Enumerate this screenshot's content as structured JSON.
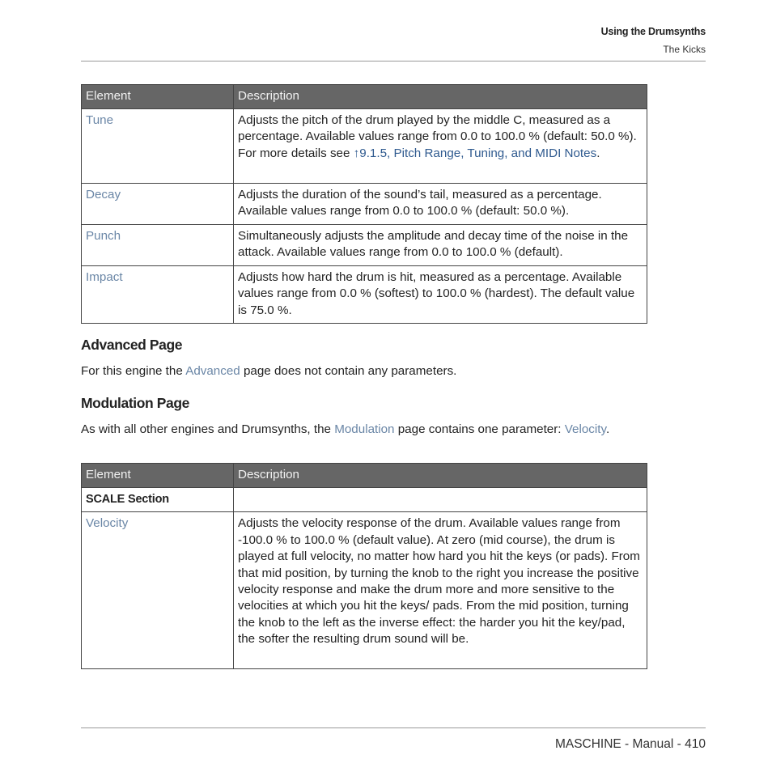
{
  "header": {
    "chapter": "Using the Drumsynths",
    "section": "The Kicks"
  },
  "table1": {
    "columns": [
      "Element",
      "Description"
    ],
    "rows": [
      {
        "element": "Tune",
        "desc_before": "Adjusts the pitch of the drum played by the middle C, measured as a percentage. Available values range from 0.0 to 100.0 % (default: 50.0 %). For more details see ",
        "desc_link": "↑9.1.5, Pitch Range, Tuning, and MIDI Notes",
        "desc_after": "."
      },
      {
        "element": "Decay",
        "desc": "Adjusts the duration of the sound’s tail, measured as a percentage. Available values range from 0.0 to 100.0 % (default: 50.0 %)."
      },
      {
        "element": "Punch",
        "desc": "Simultaneously adjusts the amplitude and decay time of the noise in the attack. Available values range from 0.0 to 100.0 % (default)."
      },
      {
        "element": "Impact",
        "desc": "Adjusts how hard the drum is hit, measured as a percentage. Available values range from 0.0 % (softest) to 100.0 % (hardest). The default value is 75.0 %."
      }
    ]
  },
  "advanced": {
    "heading": "Advanced Page",
    "text_before": "For this engine the ",
    "link": "Advanced",
    "text_after": " page does not contain any parameters."
  },
  "modulation": {
    "heading": "Modulation Page",
    "text_before": "As with all other engines and Drumsynths, the ",
    "link": "Modulation",
    "text_middle": " page contains one parameter: ",
    "param_link": "Veloc­ity",
    "text_after": "."
  },
  "table2": {
    "columns": [
      "Element",
      "Description"
    ],
    "section_label": "SCALE Section",
    "rows": [
      {
        "element": "Velocity",
        "desc": "Adjusts the velocity response of the drum. Available values range from -100.0 % to 100.0 % (default value). At zero (mid course), the drum is played at full velocity, no matter how hard you hit the keys (or pads). From that mid position, by turning the knob to the right you increase the positive velocity response and make the drum more and more sensitive to the velocities at which you hit the keys/ pads. From the mid position, turning the knob to the left as the inverse effect: the harder you hit the key/pad, the softer the resulting drum sound will be."
      }
    ]
  },
  "footer": {
    "text": "MASCHINE - Manual - 410"
  },
  "colors": {
    "table_header_bg": "#666666",
    "element_link": "#6a86a6",
    "cross_reference_link": "#2f5a8f"
  }
}
